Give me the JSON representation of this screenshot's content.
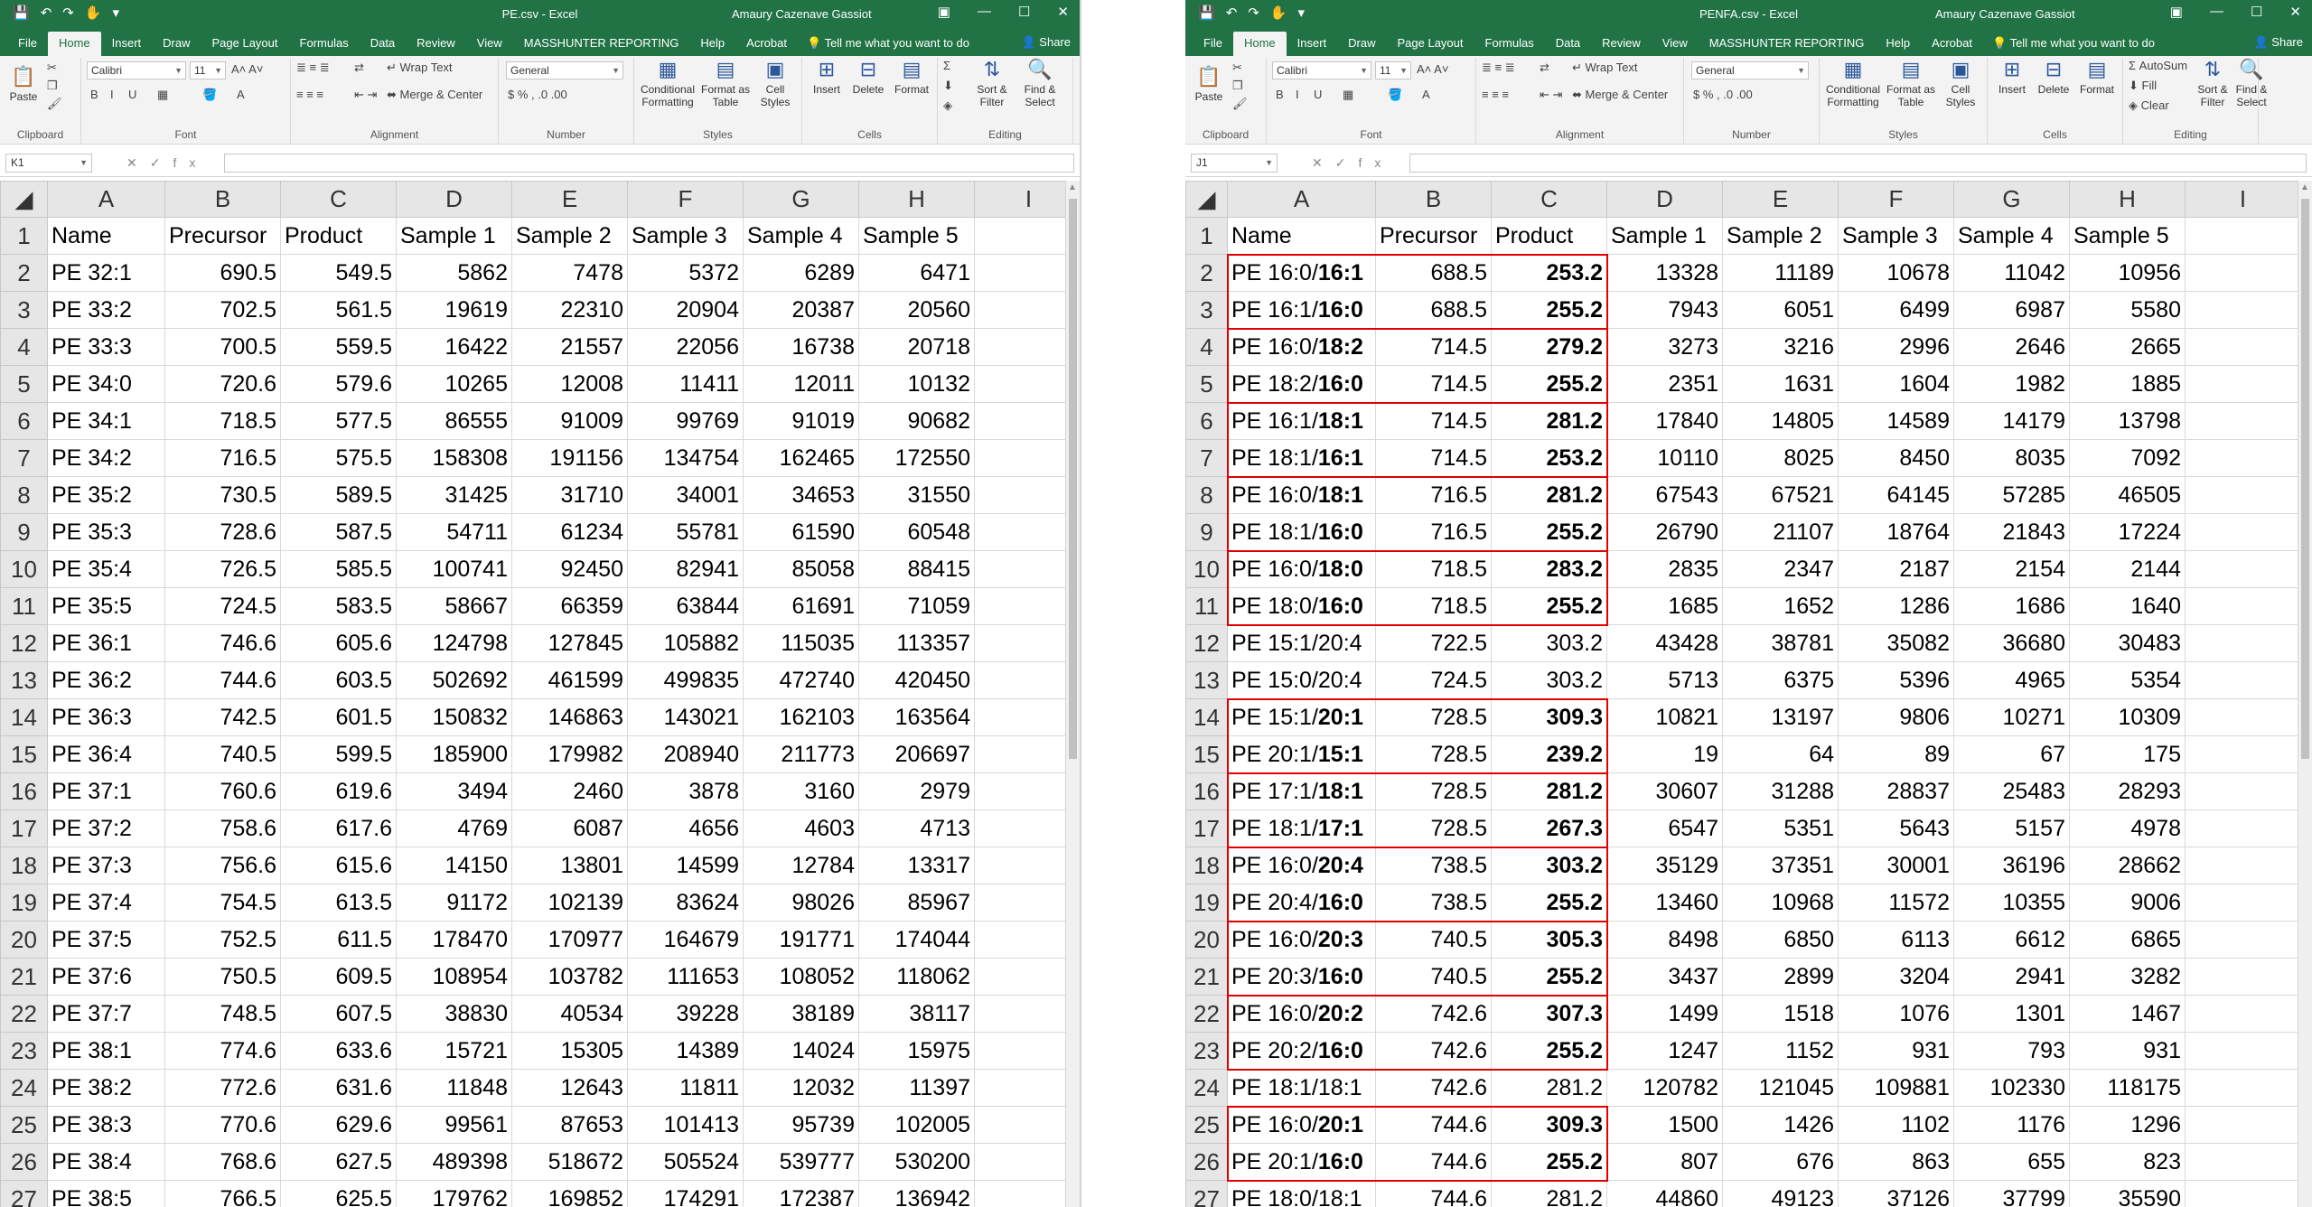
{
  "common": {
    "user": "Amaury Cazenave Gassiot",
    "share": "Share",
    "tabs": [
      "File",
      "Home",
      "Insert",
      "Draw",
      "Page Layout",
      "Formulas",
      "Data",
      "Review",
      "View",
      "MASSHUNTER REPORTING",
      "Help",
      "Acrobat"
    ],
    "tell_me": "Tell me what you want to do",
    "ribbon": {
      "paste": "Paste",
      "clipboard": "Clipboard",
      "font_name": "Calibri",
      "font_size": "11",
      "font": "Font",
      "wrap_text": "Wrap Text",
      "merge_center": "Merge & Center",
      "alignment": "Alignment",
      "number_format": "General",
      "number": "Number",
      "conditional_formatting": "Conditional Formatting",
      "format_as_table": "Format as Table",
      "cell_styles": "Cell Styles",
      "styles": "Styles",
      "insert": "Insert",
      "delete": "Delete",
      "format": "Format",
      "cells": "Cells",
      "sort_filter": "Sort & Filter",
      "find_select": "Find & Select",
      "editing": "Editing",
      "autosum": "AutoSum",
      "fill": "Fill",
      "clear": "Clear"
    },
    "fx": "fx",
    "columns": [
      "A",
      "B",
      "C",
      "D",
      "E",
      "F",
      "G",
      "H",
      "I"
    ]
  },
  "left": {
    "title": "PE.csv - Excel",
    "name_box": "K1",
    "headers": [
      "Name",
      "Precursor",
      "Product",
      "Sample 1",
      "Sample 2",
      "Sample 3",
      "Sample 4",
      "Sample 5"
    ],
    "rows": [
      [
        "PE 32:1",
        "690.5",
        "549.5",
        "5862",
        "7478",
        "5372",
        "6289",
        "6471"
      ],
      [
        "PE 33:2",
        "702.5",
        "561.5",
        "19619",
        "22310",
        "20904",
        "20387",
        "20560"
      ],
      [
        "PE 33:3",
        "700.5",
        "559.5",
        "16422",
        "21557",
        "22056",
        "16738",
        "20718"
      ],
      [
        "PE 34:0",
        "720.6",
        "579.6",
        "10265",
        "12008",
        "11411",
        "12011",
        "10132"
      ],
      [
        "PE 34:1",
        "718.5",
        "577.5",
        "86555",
        "91009",
        "99769",
        "91019",
        "90682"
      ],
      [
        "PE 34:2",
        "716.5",
        "575.5",
        "158308",
        "191156",
        "134754",
        "162465",
        "172550"
      ],
      [
        "PE 35:2",
        "730.5",
        "589.5",
        "31425",
        "31710",
        "34001",
        "34653",
        "31550"
      ],
      [
        "PE 35:3",
        "728.6",
        "587.5",
        "54711",
        "61234",
        "55781",
        "61590",
        "60548"
      ],
      [
        "PE 35:4",
        "726.5",
        "585.5",
        "100741",
        "92450",
        "82941",
        "85058",
        "88415"
      ],
      [
        "PE 35:5",
        "724.5",
        "583.5",
        "58667",
        "66359",
        "63844",
        "61691",
        "71059"
      ],
      [
        "PE 36:1",
        "746.6",
        "605.6",
        "124798",
        "127845",
        "105882",
        "115035",
        "113357"
      ],
      [
        "PE 36:2",
        "744.6",
        "603.5",
        "502692",
        "461599",
        "499835",
        "472740",
        "420450"
      ],
      [
        "PE 36:3",
        "742.5",
        "601.5",
        "150832",
        "146863",
        "143021",
        "162103",
        "163564"
      ],
      [
        "PE 36:4",
        "740.5",
        "599.5",
        "185900",
        "179982",
        "208940",
        "211773",
        "206697"
      ],
      [
        "PE 37:1",
        "760.6",
        "619.6",
        "3494",
        "2460",
        "3878",
        "3160",
        "2979"
      ],
      [
        "PE 37:2",
        "758.6",
        "617.6",
        "4769",
        "6087",
        "4656",
        "4603",
        "4713"
      ],
      [
        "PE 37:3",
        "756.6",
        "615.6",
        "14150",
        "13801",
        "14599",
        "12784",
        "13317"
      ],
      [
        "PE 37:4",
        "754.5",
        "613.5",
        "91172",
        "102139",
        "83624",
        "98026",
        "85967"
      ],
      [
        "PE 37:5",
        "752.5",
        "611.5",
        "178470",
        "170977",
        "164679",
        "191771",
        "174044"
      ],
      [
        "PE 37:6",
        "750.5",
        "609.5",
        "108954",
        "103782",
        "111653",
        "108052",
        "118062"
      ],
      [
        "PE 37:7",
        "748.5",
        "607.5",
        "38830",
        "40534",
        "39228",
        "38189",
        "38117"
      ],
      [
        "PE 38:1",
        "774.6",
        "633.6",
        "15721",
        "15305",
        "14389",
        "14024",
        "15975"
      ],
      [
        "PE 38:2",
        "772.6",
        "631.6",
        "11848",
        "12643",
        "11811",
        "12032",
        "11397"
      ],
      [
        "PE 38:3",
        "770.6",
        "629.6",
        "99561",
        "87653",
        "101413",
        "95739",
        "102005"
      ],
      [
        "PE 38:4",
        "768.6",
        "627.5",
        "489398",
        "518672",
        "505524",
        "539777",
        "530200"
      ],
      [
        "PE 38:5",
        "766.5",
        "625.5",
        "179762",
        "169852",
        "174291",
        "172387",
        "136942"
      ]
    ]
  },
  "right": {
    "title": "PENFA.csv - Excel",
    "name_box": "J1",
    "headers": [
      "Name",
      "Precursor",
      "Product",
      "Sample 1",
      "Sample 2",
      "Sample 3",
      "Sample 4",
      "Sample 5"
    ],
    "rows": [
      [
        "PE 16:0/",
        "16:1",
        "688.5",
        "253.2",
        "13328",
        "11189",
        "10678",
        "11042",
        "10956",
        true
      ],
      [
        "PE 16:1/",
        "16:0",
        "688.5",
        "255.2",
        "7943",
        "6051",
        "6499",
        "6987",
        "5580",
        true
      ],
      [
        "PE 16:0/",
        "18:2",
        "714.5",
        "279.2",
        "3273",
        "3216",
        "2996",
        "2646",
        "2665",
        true
      ],
      [
        "PE 18:2/",
        "16:0",
        "714.5",
        "255.2",
        "2351",
        "1631",
        "1604",
        "1982",
        "1885",
        true
      ],
      [
        "PE 16:1/",
        "18:1",
        "714.5",
        "281.2",
        "17840",
        "14805",
        "14589",
        "14179",
        "13798",
        true
      ],
      [
        "PE 18:1/",
        "16:1",
        "714.5",
        "253.2",
        "10110",
        "8025",
        "8450",
        "8035",
        "7092",
        true
      ],
      [
        "PE 16:0/",
        "18:1",
        "716.5",
        "281.2",
        "67543",
        "67521",
        "64145",
        "57285",
        "46505",
        true
      ],
      [
        "PE 18:1/",
        "16:0",
        "716.5",
        "255.2",
        "26790",
        "21107",
        "18764",
        "21843",
        "17224",
        true
      ],
      [
        "PE 16:0/",
        "18:0",
        "718.5",
        "283.2",
        "2835",
        "2347",
        "2187",
        "2154",
        "2144",
        true
      ],
      [
        "PE 18:0/",
        "16:0",
        "718.5",
        "255.2",
        "1685",
        "1652",
        "1286",
        "1686",
        "1640",
        true
      ],
      [
        "PE 15:1/20:4",
        "",
        "722.5",
        "303.2",
        "43428",
        "38781",
        "35082",
        "36680",
        "30483",
        false
      ],
      [
        "PE 15:0/20:4",
        "",
        "724.5",
        "303.2",
        "5713",
        "6375",
        "5396",
        "4965",
        "5354",
        false
      ],
      [
        "PE 15:1/",
        "20:1",
        "728.5",
        "309.3",
        "10821",
        "13197",
        "9806",
        "10271",
        "10309",
        true
      ],
      [
        "PE 20:1/",
        "15:1",
        "728.5",
        "239.2",
        "19",
        "64",
        "89",
        "67",
        "175",
        true
      ],
      [
        "PE 17:1/",
        "18:1",
        "728.5",
        "281.2",
        "30607",
        "31288",
        "28837",
        "25483",
        "28293",
        true
      ],
      [
        "PE 18:1/",
        "17:1",
        "728.5",
        "267.3",
        "6547",
        "5351",
        "5643",
        "5157",
        "4978",
        true
      ],
      [
        "PE 16:0/",
        "20:4",
        "738.5",
        "303.2",
        "35129",
        "37351",
        "30001",
        "36196",
        "28662",
        true
      ],
      [
        "PE 20:4/",
        "16:0",
        "738.5",
        "255.2",
        "13460",
        "10968",
        "11572",
        "10355",
        "9006",
        true
      ],
      [
        "PE 16:0/",
        "20:3",
        "740.5",
        "305.3",
        "8498",
        "6850",
        "6113",
        "6612",
        "6865",
        true
      ],
      [
        "PE 20:3/",
        "16:0",
        "740.5",
        "255.2",
        "3437",
        "2899",
        "3204",
        "2941",
        "3282",
        true
      ],
      [
        "PE 16:0/",
        "20:2",
        "742.6",
        "307.3",
        "1499",
        "1518",
        "1076",
        "1301",
        "1467",
        true
      ],
      [
        "PE 20:2/",
        "16:0",
        "742.6",
        "255.2",
        "1247",
        "1152",
        "931",
        "793",
        "931",
        true
      ],
      [
        "PE 18:1/18:1",
        "",
        "742.6",
        "281.2",
        "120782",
        "121045",
        "109881",
        "102330",
        "118175",
        false
      ],
      [
        "PE 16:0/",
        "20:1",
        "744.6",
        "309.3",
        "1500",
        "1426",
        "1102",
        "1176",
        "1296",
        true
      ],
      [
        "PE 20:1/",
        "16:0",
        "744.6",
        "255.2",
        "807",
        "676",
        "863",
        "655",
        "823",
        true
      ],
      [
        "PE 18:0/18:1",
        "",
        "744.6",
        "281.2",
        "44860",
        "49123",
        "37126",
        "37799",
        "35590",
        false
      ]
    ]
  }
}
